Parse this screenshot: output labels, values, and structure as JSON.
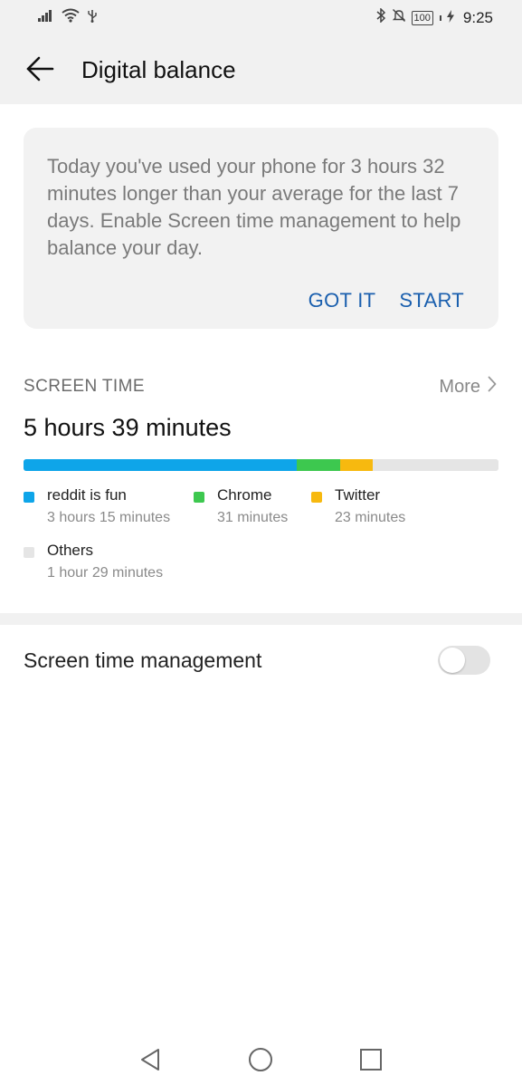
{
  "status_bar": {
    "battery": "100",
    "time": "9:25",
    "icons": [
      "signal-icon",
      "wifi-icon",
      "usb-icon",
      "bluetooth-icon",
      "notifications-off-icon",
      "battery-icon",
      "charging-icon"
    ]
  },
  "header": {
    "title": "Digital balance"
  },
  "notice_card": {
    "message": "Today you've used your phone for 3 hours 32 minutes longer than your average for the last 7 days. Enable Screen time management to help balance your day.",
    "got_it_label": "GOT IT",
    "start_label": "START"
  },
  "screen_time": {
    "section_label": "SCREEN TIME",
    "more_label": "More",
    "total": "5 hours 39 minutes",
    "apps": [
      {
        "name": "reddit is fun",
        "duration": "3 hours 15 minutes",
        "fraction": 0.5752,
        "color": "#0ea5e9"
      },
      {
        "name": "Chrome",
        "duration": "31 minutes",
        "fraction": 0.0914,
        "color": "#3dc84f"
      },
      {
        "name": "Twitter",
        "duration": "23 minutes",
        "fraction": 0.0678,
        "color": "#f7b90f"
      },
      {
        "name": "Others",
        "duration": "1 hour 29 minutes",
        "fraction": 0.2625,
        "color": "#e5e5e5"
      }
    ]
  },
  "management": {
    "label": "Screen time management",
    "enabled": false
  },
  "nav": {
    "buttons": [
      "back-nav-icon",
      "home-nav-icon",
      "recents-nav-icon"
    ]
  }
}
